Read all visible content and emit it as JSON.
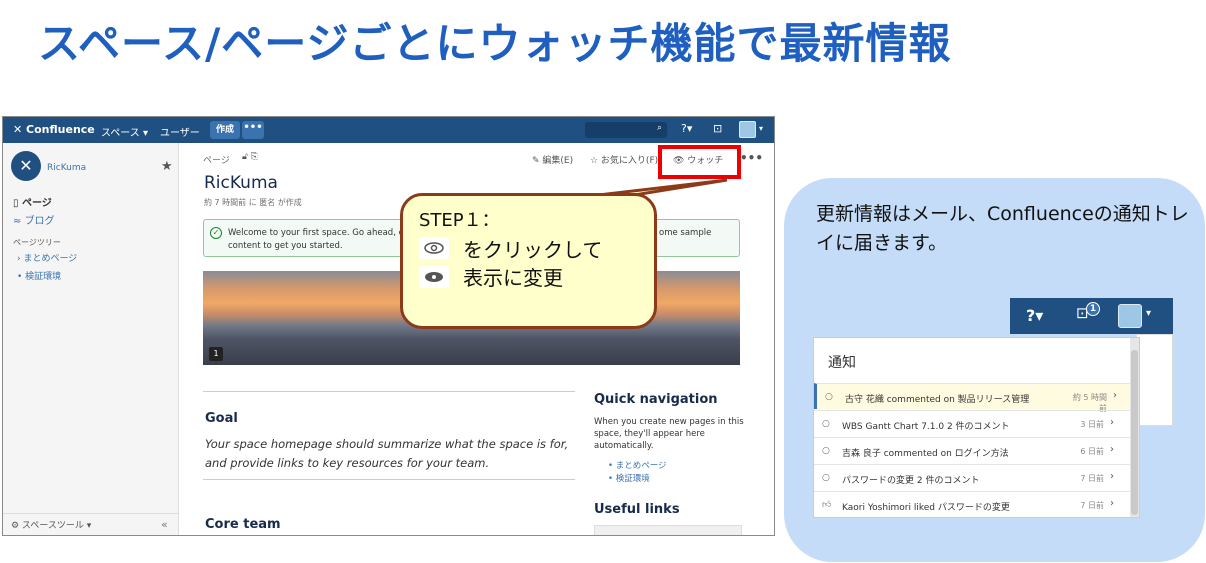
{
  "slide": {
    "title": "スペース/ページごとにウォッチ機能で最新情報"
  },
  "topbar": {
    "logo": "✕ Confluence",
    "nav": [
      "スペース ▾",
      "ユーザー"
    ],
    "create": "作成",
    "more": "•••",
    "search_icon": "🔍",
    "help": "?▾",
    "notifications_icon": "inbox-icon"
  },
  "sidebar": {
    "space_name": "RicKuma",
    "pages": "ページ",
    "blog": "ブログ",
    "tree_label": "ページツリー",
    "tree_items": [
      "› まとめページ",
      "• 検証環境"
    ],
    "tools": "⚙ スペースツール ▾",
    "collapse": "«"
  },
  "page": {
    "breadcrumb": "ページ",
    "actions": {
      "edit": "✎ 編集(E)",
      "favourite": "☆ お気に入り(F)",
      "watch": "👁 ウォッチ",
      "more": "•••"
    },
    "title": "RicKuma",
    "meta": "約 7 時間前 に 匿名 が作成",
    "welcome_left": "Welcome to your first space. Go ahead, edi",
    "welcome_right": "ome sample",
    "welcome_line2": "content to get you started.",
    "goal_heading": "Goal",
    "goal_text": "Your space homepage should summarize what the space is for, and provide links to key resources for your team.",
    "core_heading": "Core team",
    "quick_nav_heading": "Quick navigation",
    "quick_nav_text": "When you create new pages in this space, they'll appear here automatically.",
    "quick_nav_links": [
      "まとめページ",
      "検証環境"
    ],
    "useful_links_heading": "Useful links",
    "banner_comment": "1"
  },
  "callout": {
    "title": "STEP１：",
    "line1": "をクリックして",
    "line2": "表示に変更"
  },
  "bubble": {
    "text": "更新情報はメール、Confluenceの通知トレイに届きます。",
    "badge": "1",
    "panel_title": "通知",
    "notifications": [
      {
        "icon": "comment-icon",
        "text": "古守 花織 commented on 製品リリース管理",
        "time": "約 5 時間前"
      },
      {
        "icon": "comment-icon",
        "text": "WBS Gantt Chart 7.1.0 2 件のコメント",
        "time": "3 日前"
      },
      {
        "icon": "comment-icon",
        "text": "吉森 良子 commented on ログイン方法",
        "time": "6 日前"
      },
      {
        "icon": "comment-icon",
        "text": "パスワードの変更 2 件のコメント",
        "time": "7 日前"
      },
      {
        "icon": "like-icon",
        "text": "Kaori Yoshimori liked パスワードの変更",
        "time": "7 日前"
      }
    ]
  }
}
